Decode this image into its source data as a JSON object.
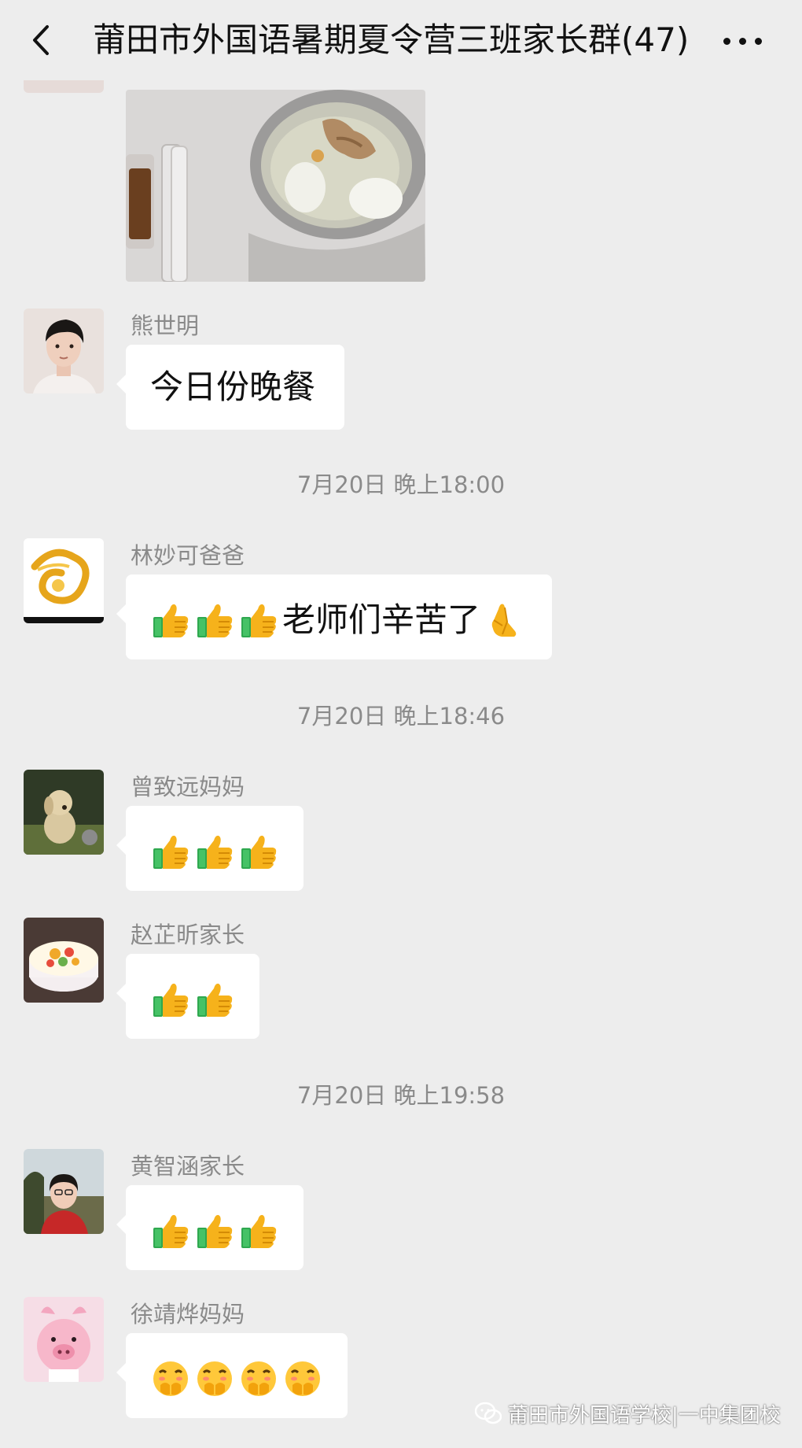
{
  "header": {
    "title": "莆田市外国语暑期夏令营三班家长群(47)"
  },
  "messages": [
    {
      "sender": "熊世明",
      "text": "今日份晚餐"
    },
    {
      "time": "7月20日 晚上18:00"
    },
    {
      "sender": "林妙可爸爸",
      "text": "老师们辛苦了"
    },
    {
      "time": "7月20日 晚上18:46"
    },
    {
      "sender": "曾致远妈妈"
    },
    {
      "sender": "赵芷昕家长"
    },
    {
      "time": "7月20日 晚上19:58"
    },
    {
      "sender": "黄智涵家长"
    },
    {
      "sender": "徐靖烨妈妈"
    }
  ],
  "icons": {
    "back": "chevron-left-icon",
    "more": "more-icon",
    "thumbs_up": "thumbs-up-icon",
    "pray": "pray-icon",
    "hands_face": "hand-over-mouth-icon",
    "wechat": "wechat-icon"
  },
  "watermark": {
    "text": "莆田市外国语学校|一中集团校"
  },
  "colors": {
    "background": "#ededed",
    "bubble": "#ffffff",
    "meta_text": "#8a8a8a"
  }
}
